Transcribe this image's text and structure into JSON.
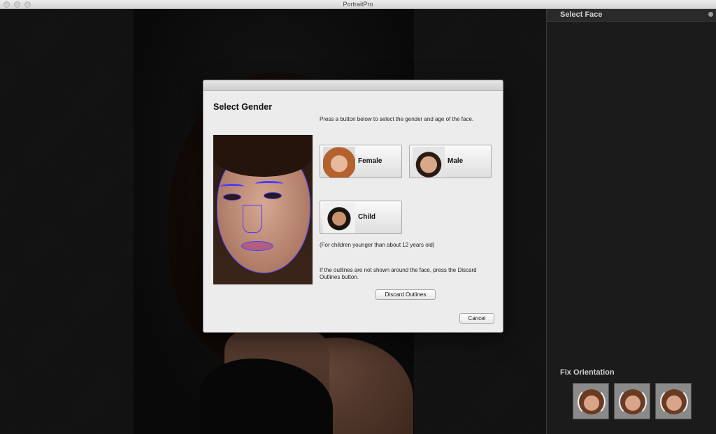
{
  "window": {
    "title": "PortraitPro"
  },
  "sidebar": {
    "select_face_title": "Select Face",
    "fix_orientation_title": "Fix Orientation",
    "orientation_buttons": [
      "rotate-left",
      "rotate-180",
      "rotate-right"
    ]
  },
  "dialog": {
    "title": "Select Gender",
    "instruction": "Press a button below to select the gender and age of the face.",
    "buttons": {
      "female": "Female",
      "male": "Male",
      "child": "Child"
    },
    "child_note": "(For children younger than about 12 years old)",
    "outline_help": "If the outlines are not shown around the face, press the Discard Outlines button.",
    "discard_label": "Discard Outlines",
    "cancel_label": "Cancel"
  },
  "colors": {
    "outline": "#4b3cff",
    "dialog_bg": "#ececec",
    "sidebar_bg": "#1b1b1b"
  }
}
